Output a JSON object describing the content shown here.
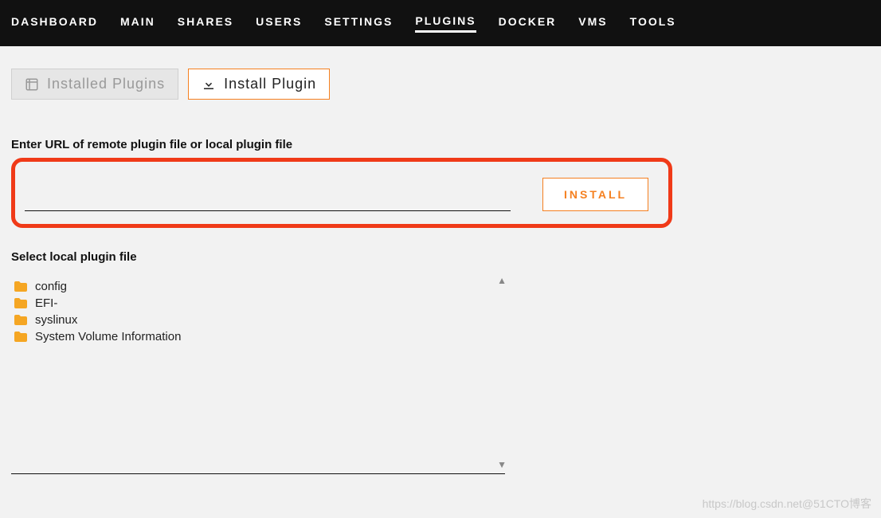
{
  "nav": {
    "items": [
      {
        "label": "DASHBOARD"
      },
      {
        "label": "MAIN"
      },
      {
        "label": "SHARES"
      },
      {
        "label": "USERS"
      },
      {
        "label": "SETTINGS"
      },
      {
        "label": "PLUGINS",
        "active": true
      },
      {
        "label": "DOCKER"
      },
      {
        "label": "VMS"
      },
      {
        "label": "TOOLS"
      }
    ]
  },
  "tabs": {
    "installed": {
      "label": "Installed Plugins"
    },
    "install": {
      "label": "Install Plugin"
    }
  },
  "form": {
    "url_label": "Enter URL of remote plugin file or local plugin file",
    "url_value": "",
    "install_button": "INSTALL",
    "select_label": "Select local plugin file"
  },
  "files": [
    {
      "name": "config"
    },
    {
      "name": "EFI-"
    },
    {
      "name": "syslinux"
    },
    {
      "name": "System Volume Information"
    }
  ],
  "watermark": "https://blog.csdn.net@51CTO博客"
}
